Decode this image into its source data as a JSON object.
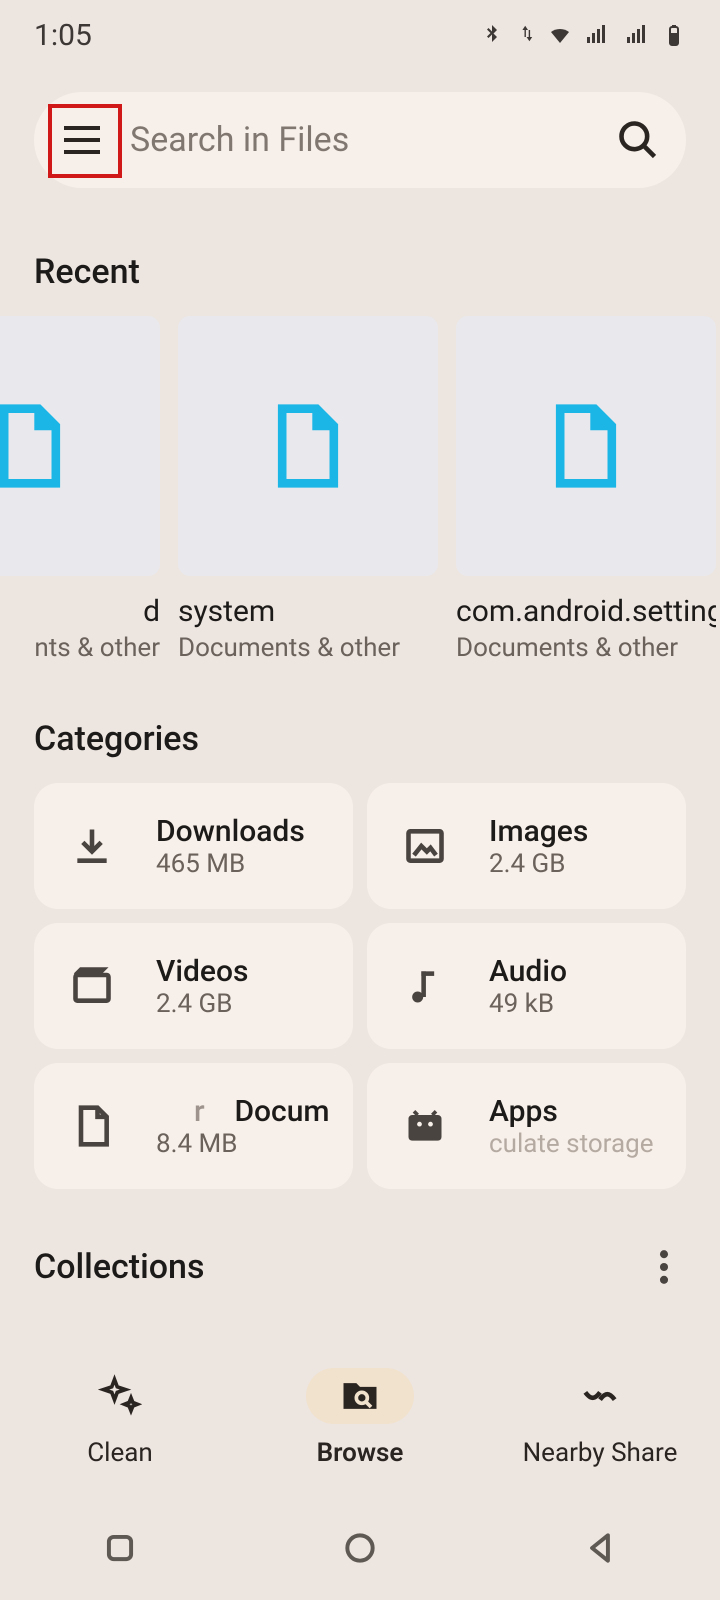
{
  "status": {
    "time": "1:05"
  },
  "search": {
    "placeholder": "Search in Files"
  },
  "sections": {
    "recent": "Recent",
    "categories": "Categories",
    "collections": "Collections"
  },
  "recent_items": [
    {
      "name": "d",
      "sub": "nts & other"
    },
    {
      "name": "system",
      "sub": "Documents & other"
    },
    {
      "name": "com.android.settings",
      "sub": "Documents & other"
    }
  ],
  "categories": [
    {
      "icon": "download",
      "name": "Downloads",
      "size": "465 MB"
    },
    {
      "icon": "image",
      "name": "Images",
      "size": "2.4 GB"
    },
    {
      "icon": "video",
      "name": "Videos",
      "size": "2.4 GB"
    },
    {
      "icon": "audio",
      "name": "Audio",
      "size": "49 kB"
    },
    {
      "icon": "document",
      "name": "Docum",
      "size": "8.4 MB"
    },
    {
      "icon": "apps",
      "name": "Apps",
      "size": "culate storage"
    }
  ],
  "nav": {
    "clean": "Clean",
    "browse": "Browse",
    "nearby": "Nearby Share",
    "active": "browse"
  }
}
